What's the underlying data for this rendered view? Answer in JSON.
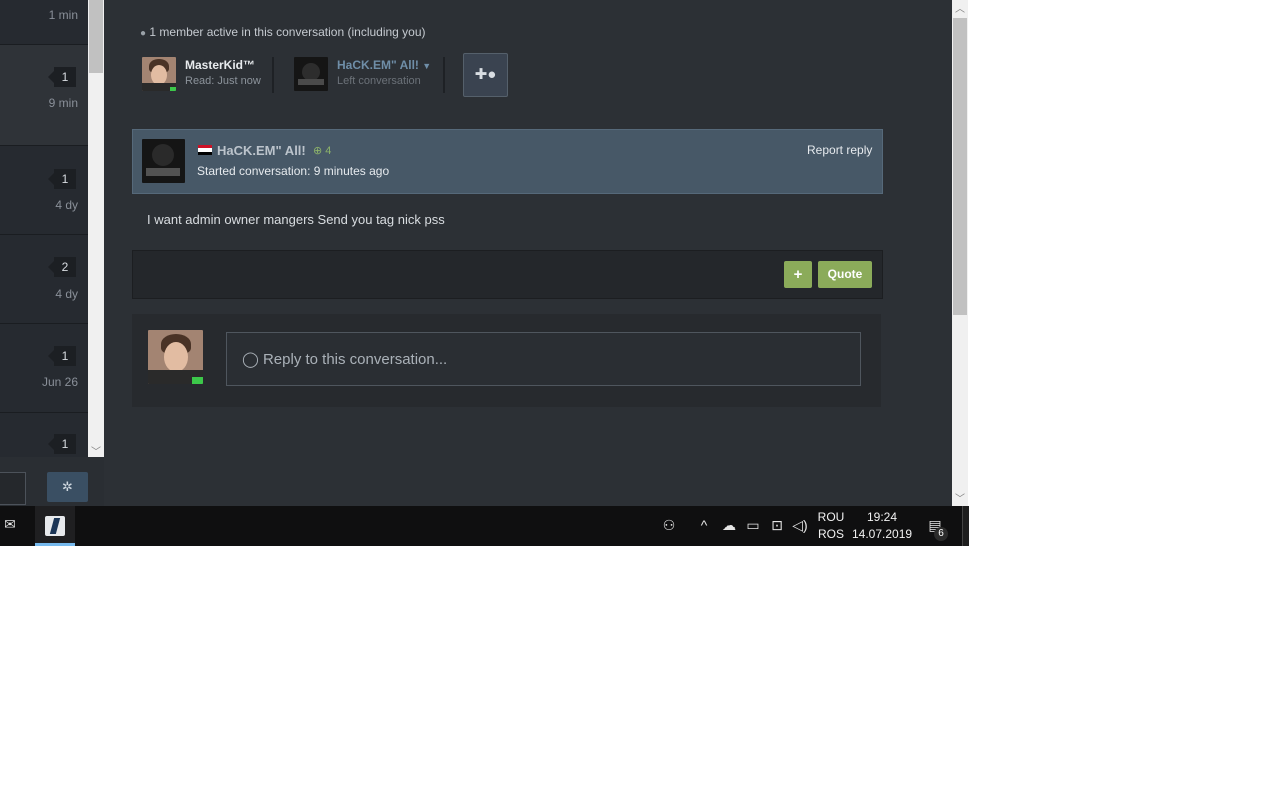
{
  "conversation_list": {
    "rows": [
      {
        "count": "",
        "time": "1 min"
      },
      {
        "count": "1",
        "time": "9 min"
      },
      {
        "count": "1",
        "time": "4 dy"
      },
      {
        "count": "2",
        "time": "4 dy"
      },
      {
        "count": "1",
        "time": "Jun 26"
      },
      {
        "count": "1",
        "time": ""
      }
    ]
  },
  "participants": {
    "summary": "1 member active in this conversation (including you)",
    "members": [
      {
        "name": "MasterKid™",
        "status": "Read: Just now"
      },
      {
        "name": "HaCK.EM\" All!",
        "status": "Left conversation"
      }
    ]
  },
  "message": {
    "author": "HaCK.EM\" All!",
    "reputation": "4",
    "started": "Started conversation: 9 minutes ago",
    "report_label": "Report reply",
    "body": "I want admin owner mangers Send you tag nick pss",
    "plus_label": "+",
    "quote_label": "Quote"
  },
  "reply": {
    "placeholder": "Reply to this conversation..."
  },
  "taskbar": {
    "lang_top": "ROU",
    "lang_bottom": "ROS",
    "time": "19:24",
    "date": "14.07.2019",
    "notifications": "6"
  },
  "colors": {
    "accent_green": "#8bab5a",
    "header_blue": "#475867",
    "page_dark": "#2c3035"
  }
}
